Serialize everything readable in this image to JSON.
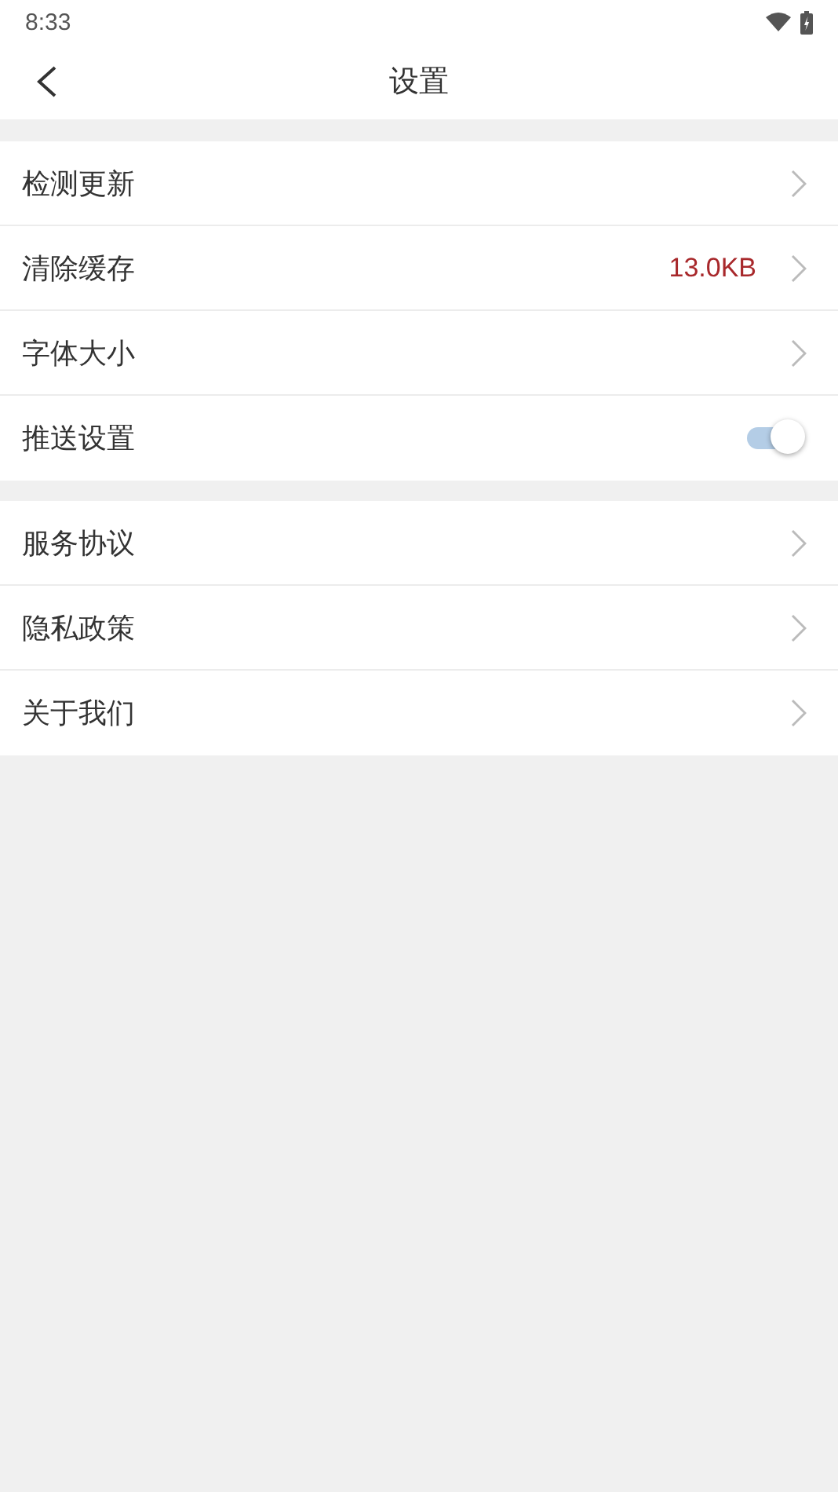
{
  "status_bar": {
    "time": "8:33"
  },
  "header": {
    "title": "设置"
  },
  "groups": [
    {
      "items": [
        {
          "kind": "link",
          "label": "检测更新"
        },
        {
          "kind": "value",
          "label": "清除缓存",
          "value": "13.0KB"
        },
        {
          "kind": "link",
          "label": "字体大小"
        },
        {
          "kind": "toggle",
          "label": "推送设置",
          "on": true
        }
      ]
    },
    {
      "items": [
        {
          "kind": "link",
          "label": "服务协议"
        },
        {
          "kind": "link",
          "label": "隐私政策"
        },
        {
          "kind": "link",
          "label": "关于我们"
        }
      ]
    }
  ]
}
